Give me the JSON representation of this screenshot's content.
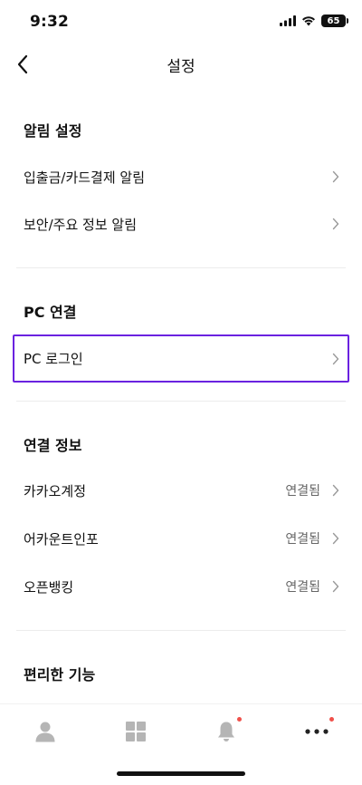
{
  "status_bar": {
    "time": "9:32",
    "battery": "65"
  },
  "header": {
    "title": "설정"
  },
  "sections": {
    "alerts": {
      "title": "알림 설정",
      "items": [
        {
          "label": "입출금/카드결제 알림"
        },
        {
          "label": "보안/주요 정보 알림"
        }
      ]
    },
    "pc": {
      "title": "PC 연결",
      "items": [
        {
          "label": "PC 로그인"
        }
      ]
    },
    "connections": {
      "title": "연결 정보",
      "items": [
        {
          "label": "카카오계정",
          "value": "연결됨"
        },
        {
          "label": "어카운트인포",
          "value": "연결됨"
        },
        {
          "label": "오픈뱅킹",
          "value": "연결됨"
        }
      ]
    },
    "convenience": {
      "title": "편리한 기능"
    }
  },
  "bottom_nav": {
    "items": [
      {
        "icon": "person-icon"
      },
      {
        "icon": "grid-icon"
      },
      {
        "icon": "bell-icon",
        "badge": true
      },
      {
        "icon": "more-icon",
        "badge": true
      }
    ]
  },
  "colors": {
    "highlight_border": "#6a22e0",
    "badge": "#f0504a",
    "nav_icon": "#b5b5b5"
  }
}
